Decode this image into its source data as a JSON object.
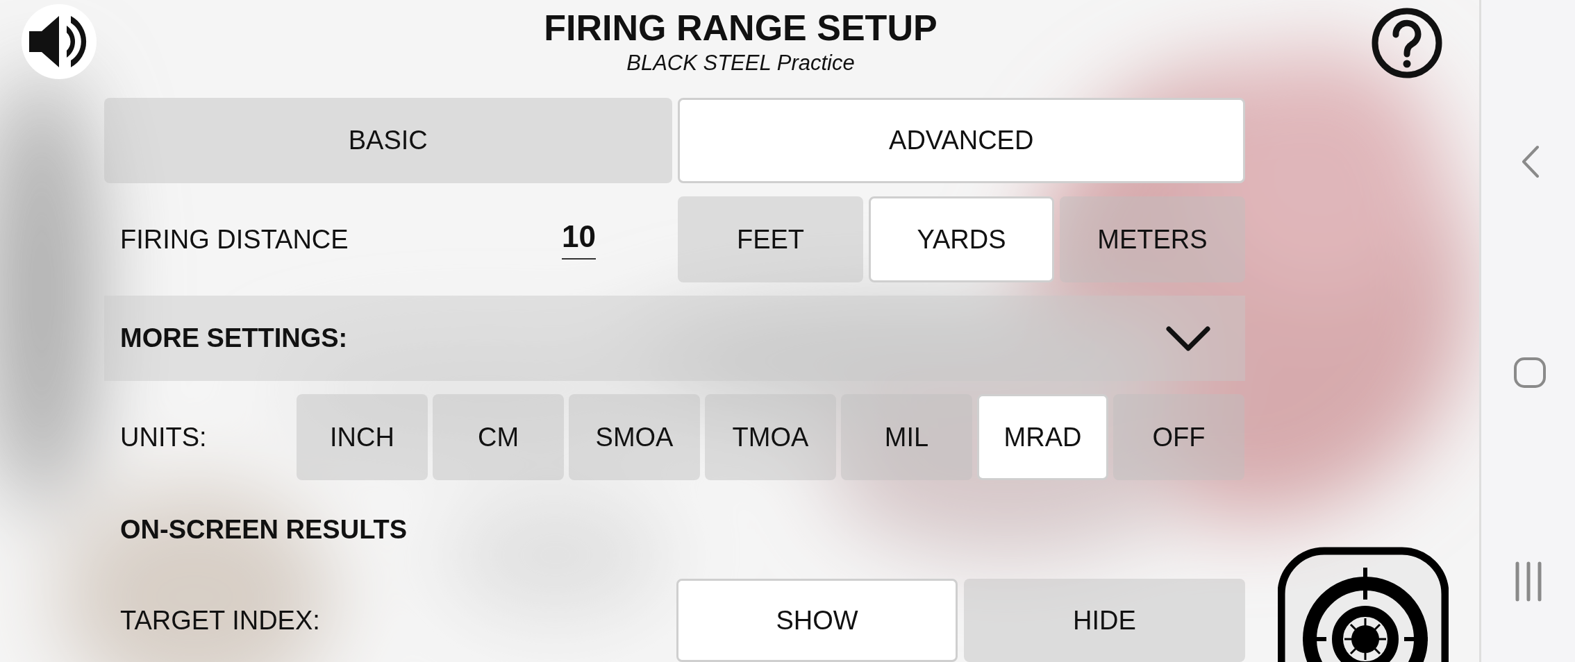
{
  "header": {
    "title": "FIRING RANGE SETUP",
    "subtitle": "BLACK STEEL Practice"
  },
  "mode_tabs": [
    {
      "label": "BASIC",
      "selected": false
    },
    {
      "label": "ADVANCED",
      "selected": true
    }
  ],
  "firing_distance": {
    "label": "FIRING DISTANCE",
    "value": "10",
    "units": [
      {
        "label": "FEET",
        "selected": false
      },
      {
        "label": "YARDS",
        "selected": true
      },
      {
        "label": "METERS",
        "selected": false
      }
    ]
  },
  "more_settings": {
    "label": "MORE SETTINGS:"
  },
  "units": {
    "label": "UNITS:",
    "options": [
      {
        "label": "INCH",
        "selected": false
      },
      {
        "label": "CM",
        "selected": false
      },
      {
        "label": "SMOA",
        "selected": false
      },
      {
        "label": "TMOA",
        "selected": false
      },
      {
        "label": "MIL",
        "selected": false
      },
      {
        "label": "MRAD",
        "selected": true
      },
      {
        "label": "OFF",
        "selected": false
      }
    ]
  },
  "on_screen_results": {
    "title": "ON-SCREEN RESULTS"
  },
  "target_index": {
    "label": "TARGET INDEX:",
    "options": [
      {
        "label": "SHOW",
        "selected": true
      },
      {
        "label": "HIDE",
        "selected": false
      }
    ]
  }
}
